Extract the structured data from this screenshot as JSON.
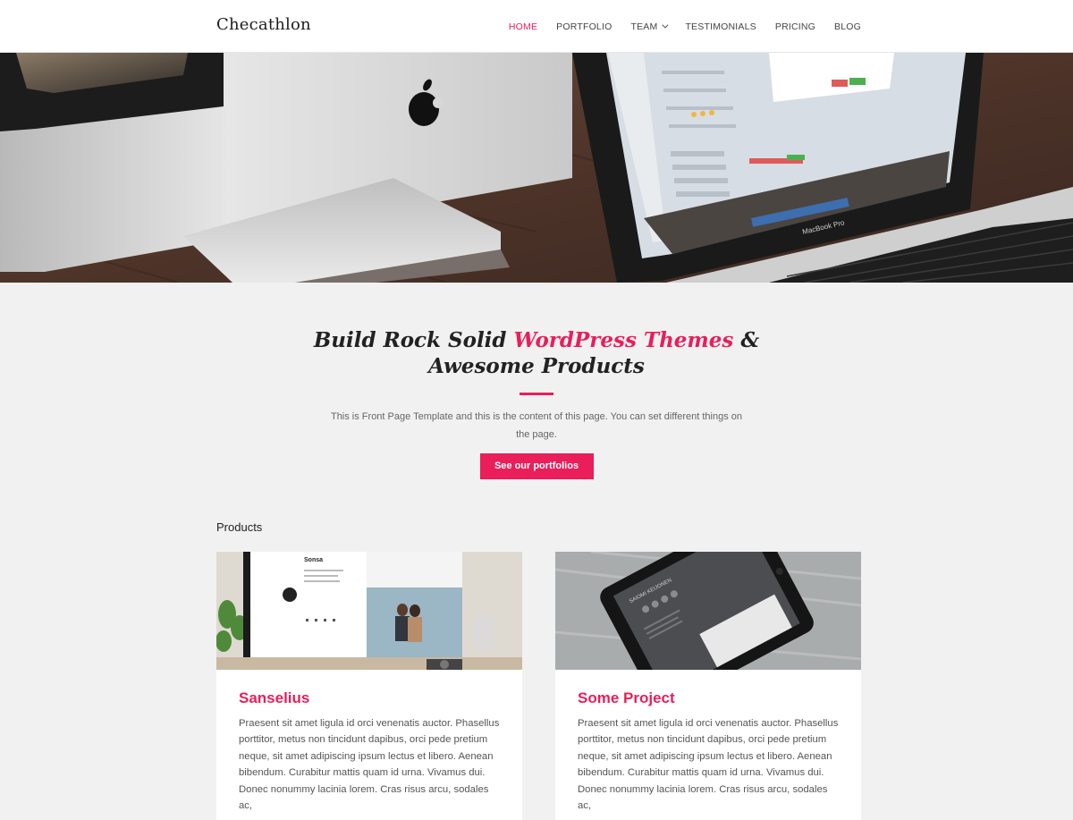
{
  "header": {
    "logo": "Checathlon",
    "nav": [
      {
        "label": "HOME",
        "active": true,
        "has_dropdown": false
      },
      {
        "label": "PORTFOLIO",
        "active": false,
        "has_dropdown": false
      },
      {
        "label": "TEAM",
        "active": false,
        "has_dropdown": true
      },
      {
        "label": "TESTIMONIALS",
        "active": false,
        "has_dropdown": false
      },
      {
        "label": "PRICING",
        "active": false,
        "has_dropdown": false
      },
      {
        "label": "BLOG",
        "active": false,
        "has_dropdown": false
      }
    ]
  },
  "hero": {
    "laptop_label": "MacBook Pro"
  },
  "intro": {
    "title_part1": "Build Rock Solid",
    "title_accent": "WordPress Themes",
    "title_part2": "&",
    "title_line2": "Awesome Products",
    "text": "This is Front Page Template and this is the content of this page. You can set different things on the page.",
    "button_label": "See our portfolios"
  },
  "products": {
    "heading": "Products",
    "items": [
      {
        "title": "Sanselius",
        "image_caption": "Sonsa",
        "text": "Praesent sit amet ligula id orci venenatis auctor. Phasellus porttitor, metus non tincidunt dapibus, orci pede pretium neque, sit amet adipiscing ipsum lectus et libero. Aenean bibendum. Curabitur mattis quam id urna. Vivamus dui. Donec nonummy lacinia lorem. Cras risus arcu, sodales ac,"
      },
      {
        "title": "Some Project",
        "image_caption": "SAIOMI KEIJONEN",
        "text": "Praesent sit amet ligula id orci venenatis auctor. Phasellus porttitor, metus non tincidunt dapibus, orci pede pretium neque, sit amet adipiscing ipsum lectus et libero. Aenean bibendum. Curabitur mattis quam id urna. Vivamus dui. Donec nonummy lacinia lorem. Cras risus arcu, sodales ac,"
      }
    ]
  },
  "colors": {
    "accent": "#e91e5a",
    "background": "#f1f1f1",
    "header_bg": "#ffffff"
  }
}
